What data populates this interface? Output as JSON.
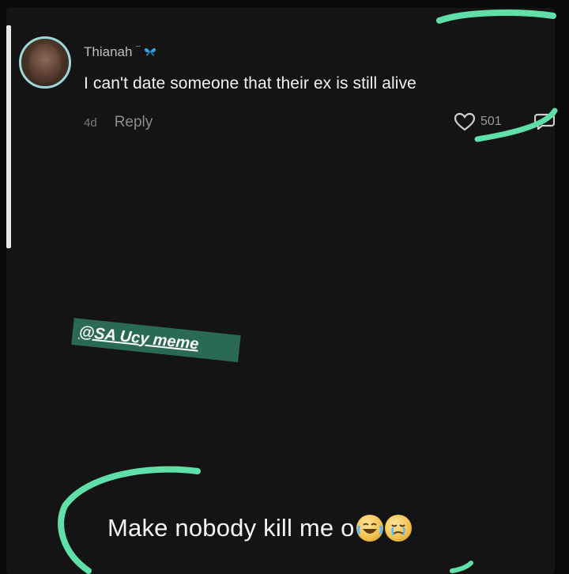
{
  "comment": {
    "username": "Thianah",
    "username_badge": "ˉˉ",
    "text": "I can't date someone that their ex is still alive",
    "timestamp": "4d",
    "reply_label": "Reply",
    "like_count": "501"
  },
  "watermark": {
    "text": "@SA Ucy meme"
  },
  "caption": {
    "text": "Make nobody kill me o"
  },
  "icons": {
    "avatar": "profile-photo",
    "badge": "butterfly-icon",
    "like": "heart-outline-icon",
    "reply_bubble": "comment-bubble-icon",
    "emoji_1": "face-with-tears-of-joy-icon",
    "emoji_2": "face-with-tears-icon"
  },
  "colors": {
    "background": "#141414",
    "highlight_stroke": "#5ee0a8",
    "watermark_bg": "#2a6a52",
    "avatar_ring": "#9fd7d9"
  }
}
